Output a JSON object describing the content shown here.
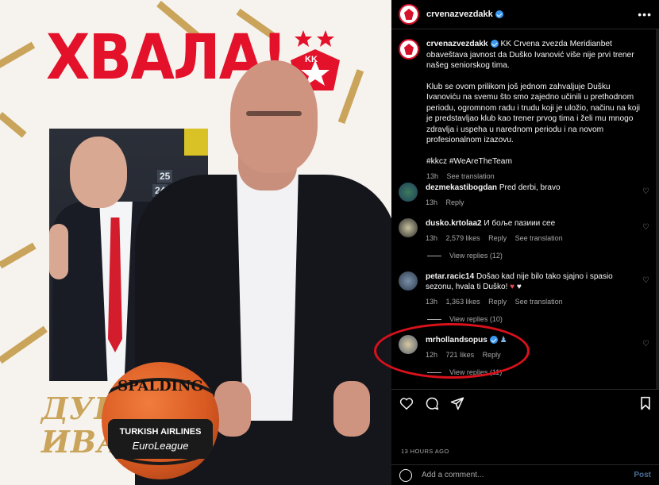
{
  "post_image": {
    "headline": "ХВАЛА!",
    "crest_text": "KK",
    "name_line1": "ДУШКО",
    "name_line2": "ИВАНОВИЋ",
    "inset_seat1": "25",
    "inset_seat2": "24",
    "ball_brand": "SPALDING",
    "ball_sponsor": "TURKISH AIRLINES",
    "ball_league": "EuroLeague"
  },
  "header": {
    "username": "crvenazvezdakk",
    "more_icon": "more-options-icon"
  },
  "caption": {
    "username": "crvenazvezdakk",
    "p1": "KK Crvena zvezda Meridianbet obaveštava javnost da Duško Ivanović više nije prvi trener našeg seniorskog tima.",
    "p2": "Klub se ovom prilikom još jednom zahvaljuje Dušku Ivanoviću na svemu što smo zajedno učinili u prethodnom periodu, ogromnom radu i trudu koji je uložio, načinu na koji je predstavljao klub kao trener prvog tima i želi mu mnogo zdravlja i uspeha u narednom periodu i na novom profesionalnom izazovu.",
    "tags": "#kkcz #WeAreTheTeam",
    "time": "13h",
    "see_translation": "See translation"
  },
  "comments": [
    {
      "username": "dezmekastibogdan",
      "text": "Pred derbi, bravo",
      "time": "13h",
      "likes": "",
      "reply": "Reply",
      "see_translation": "",
      "view_replies": ""
    },
    {
      "username": "dusko.krtolaa2",
      "text": "И боље пазиии сее",
      "time": "13h",
      "likes": "2,579 likes",
      "reply": "Reply",
      "see_translation": "See translation",
      "view_replies": "View replies (12)"
    },
    {
      "username": "petar.racic14",
      "text": "Došao kad nije bilo tako sjajno i spasio sezonu, hvala ti Duško!",
      "time": "13h",
      "likes": "1,363 likes",
      "reply": "Reply",
      "see_translation": "See translation",
      "view_replies": "View replies (10)"
    },
    {
      "username": "mrhollandsopus",
      "text": "",
      "time": "12h",
      "likes": "721 likes",
      "reply": "Reply",
      "see_translation": "",
      "view_replies": "View replies (11)"
    }
  ],
  "actions": {
    "like_icon": "heart-icon",
    "comment_icon": "comment-icon",
    "share_icon": "share-icon",
    "save_icon": "bookmark-icon"
  },
  "time_ago": "13 HOURS AGO",
  "add_comment": {
    "placeholder": "Add a comment...",
    "post_label": "Post"
  },
  "colors": {
    "brand_red": "#e4112a",
    "gold": "#c9a45a",
    "annotation_red": "#d8111b",
    "verified_blue": "#3897f0"
  }
}
